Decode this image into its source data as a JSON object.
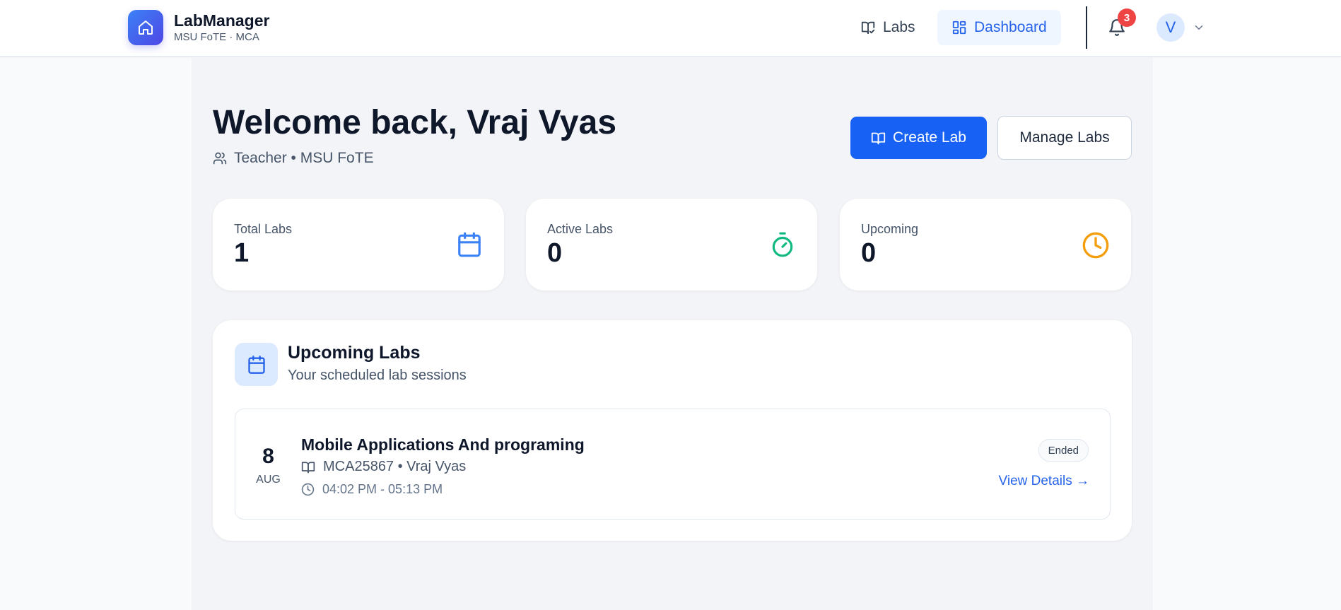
{
  "header": {
    "brand_name": "LabManager",
    "brand_sub": "MSU FoTE · MCA",
    "nav": [
      {
        "label": "Labs",
        "icon": "book-open-check-icon",
        "active": false
      },
      {
        "label": "Dashboard",
        "icon": "layout-dashboard-icon",
        "active": true
      }
    ],
    "notifications_count": "3",
    "avatar_initial": "V"
  },
  "welcome": {
    "title": "Welcome back, Vraj Vyas",
    "role_line": "Teacher • MSU FoTE",
    "create_button": "Create Lab",
    "manage_button": "Manage Labs"
  },
  "stats": [
    {
      "label": "Total Labs",
      "value": "1",
      "icon": "calendar-icon",
      "color": "#3b82f6"
    },
    {
      "label": "Active Labs",
      "value": "0",
      "icon": "timer-icon",
      "color": "#10b981"
    },
    {
      "label": "Upcoming",
      "value": "0",
      "icon": "clock-icon",
      "color": "#f59e0b"
    }
  ],
  "upcoming": {
    "title": "Upcoming Labs",
    "subtitle": "Your scheduled lab sessions",
    "items": [
      {
        "day": "8",
        "month": "AUG",
        "title": "Mobile Applications And programing",
        "meta": "MCA25867 • Vraj Vyas",
        "time": "04:02 PM - 05:13 PM",
        "status": "Ended",
        "link": "View Details →"
      }
    ]
  },
  "colors": {
    "accent": "#1762f5",
    "link": "#2563eb",
    "badge": "#ef4444"
  }
}
